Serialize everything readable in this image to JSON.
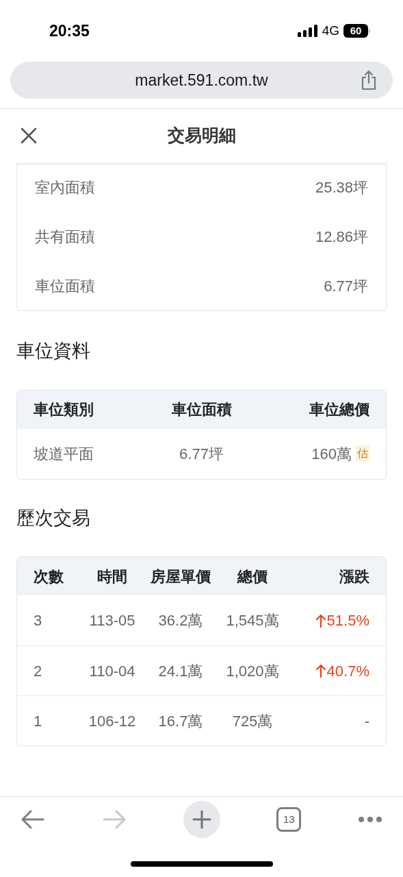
{
  "status_bar": {
    "time": "20:35",
    "network": "4G",
    "battery": "60"
  },
  "browser": {
    "url": "market.591.com.tw"
  },
  "header": {
    "title": "交易明細"
  },
  "area_rows": [
    {
      "label": "室內面積",
      "value": "25.38坪"
    },
    {
      "label": "共有面積",
      "value": "12.86坪"
    },
    {
      "label": "車位面積",
      "value": "6.77坪"
    }
  ],
  "parking": {
    "title": "車位資料",
    "columns": [
      "車位類別",
      "車位面積",
      "車位總價"
    ],
    "rows": [
      {
        "type": "坡道平面",
        "area": "6.77坪",
        "price": "160萬",
        "tag": "估"
      }
    ]
  },
  "history": {
    "title": "歷次交易",
    "columns": [
      "次數",
      "時間",
      "房屋單價",
      "總價",
      "漲跌"
    ],
    "rows": [
      {
        "count": "3",
        "date": "113-05",
        "unit_price": "36.2萬",
        "total": "1,545萬",
        "change": "51.5%",
        "kind": "rise"
      },
      {
        "count": "2",
        "date": "110-04",
        "unit_price": "24.1萬",
        "total": "1,020萬",
        "change": "40.7%",
        "kind": "rise"
      },
      {
        "count": "1",
        "date": "106-12",
        "unit_price": "16.7萬",
        "total": "725萬",
        "change": "-",
        "kind": "flat"
      }
    ]
  },
  "toolbar": {
    "tab_count": "13",
    "forward_disabled": true
  }
}
